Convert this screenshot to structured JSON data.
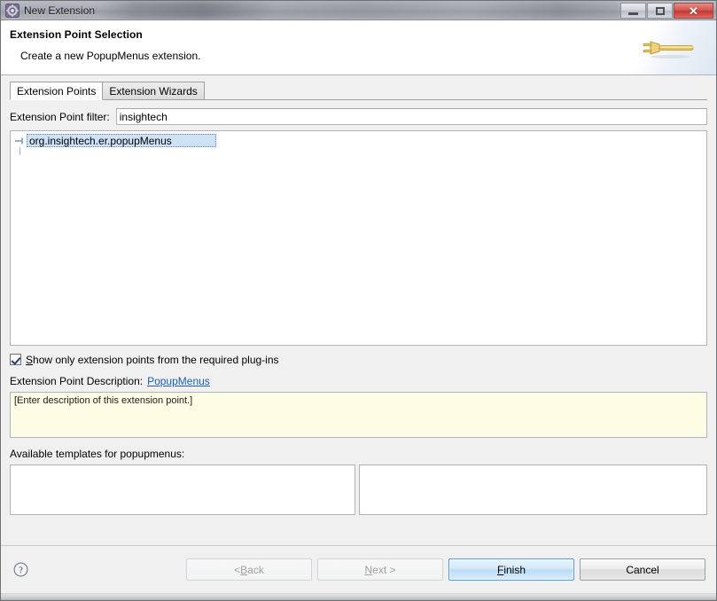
{
  "window": {
    "title": "New Extension",
    "icon": "eclipse-gear-icon",
    "controls": {
      "minimize": "minimize-icon",
      "maximize": "maximize-icon",
      "close": "close-icon"
    }
  },
  "header": {
    "title": "Extension Point Selection",
    "subtitle": "Create a new PopupMenus extension.",
    "graphic_icon": "plug-icon"
  },
  "tabs": [
    {
      "label": "Extension Points",
      "active": true
    },
    {
      "label": "Extension Wizards",
      "active": false
    }
  ],
  "filter": {
    "label": "Extension Point filter:",
    "value": "insightech",
    "placeholder": ""
  },
  "tree": {
    "items": [
      {
        "label": "org.insightech.er.popupMenus",
        "selected": true,
        "expander": "collapse-icon"
      }
    ]
  },
  "options": {
    "show_required_only": {
      "label_prefix": "",
      "label_mnemonic": "S",
      "label_rest": "how only extension points from the required plug-ins",
      "checked": true
    }
  },
  "description": {
    "label": "Extension Point Description:",
    "link": "PopupMenus",
    "body": "[Enter description of this extension point.]"
  },
  "templates": {
    "label": "Available templates for popupmenus:",
    "left_items": [],
    "right_items": []
  },
  "footer": {
    "help_icon": "help-question-icon",
    "buttons": [
      {
        "name": "back",
        "label_prefix": "< ",
        "label_mnemonic": "B",
        "label_rest": "ack",
        "state": "disabled"
      },
      {
        "name": "next",
        "label_prefix": "",
        "label_mnemonic": "N",
        "label_rest": "ext >",
        "state": "disabled"
      },
      {
        "name": "finish",
        "label_prefix": "",
        "label_mnemonic": "F",
        "label_rest": "inish",
        "state": "primary"
      },
      {
        "name": "cancel",
        "label_prefix": "",
        "label_mnemonic": "",
        "label_rest": "Cancel",
        "state": "normal"
      }
    ]
  },
  "colors": {
    "selection_blue": "#cfe1f5",
    "link_blue": "#1a5fb4",
    "description_yellow": "#fdfce4",
    "primary_button_blue": "#b9dcf7",
    "close_red": "#bf3a33",
    "plug_gold": "#e8c75a"
  }
}
